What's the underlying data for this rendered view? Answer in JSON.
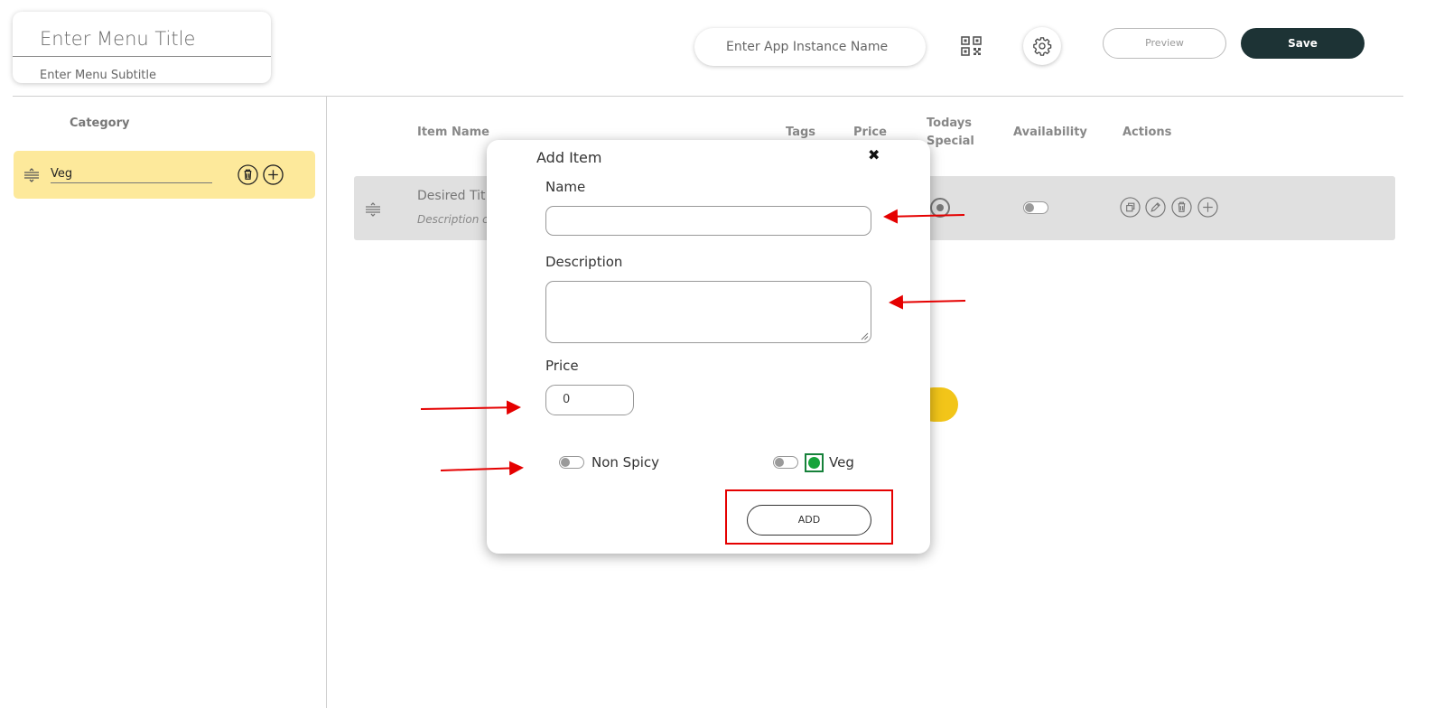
{
  "header": {
    "menu_title_placeholder": "Enter Menu Title",
    "menu_subtitle_placeholder": "Enter Menu Subtitle",
    "app_instance_placeholder": "Enter App Instance Name",
    "qr_icon": "qr-code-icon",
    "settings_icon": "gear-icon",
    "preview_label": "Preview",
    "save_label": "Save"
  },
  "categories": {
    "heading": "Category",
    "items": [
      {
        "name": "Veg",
        "icons": [
          "drag-handle-icon",
          "trash-icon",
          "plus-icon"
        ]
      }
    ]
  },
  "table": {
    "columns": {
      "item_name": "Item Name",
      "tags": "Tags",
      "price": "Price",
      "todays_special_1": "Todays",
      "todays_special_2": "Special",
      "availability": "Availability",
      "actions": "Actions"
    },
    "rows": [
      {
        "title": "Desired Tit",
        "description": "Description c",
        "action_icons": [
          "duplicate-icon",
          "edit-icon",
          "trash-icon",
          "plus-icon"
        ]
      }
    ]
  },
  "modal": {
    "title": "Add Item",
    "close_symbol": "✖",
    "name_label": "Name",
    "description_label": "Description",
    "price_label": "Price",
    "price_value": "0",
    "spicy_label": "Non Spicy",
    "veg_label": "Veg",
    "add_label": "ADD"
  },
  "colors": {
    "category_highlight": "#fde99b",
    "save_button": "#1d3335",
    "accent_yellow": "#f2c519",
    "veg_green": "#16a33a",
    "annotation_red": "#e50000"
  }
}
